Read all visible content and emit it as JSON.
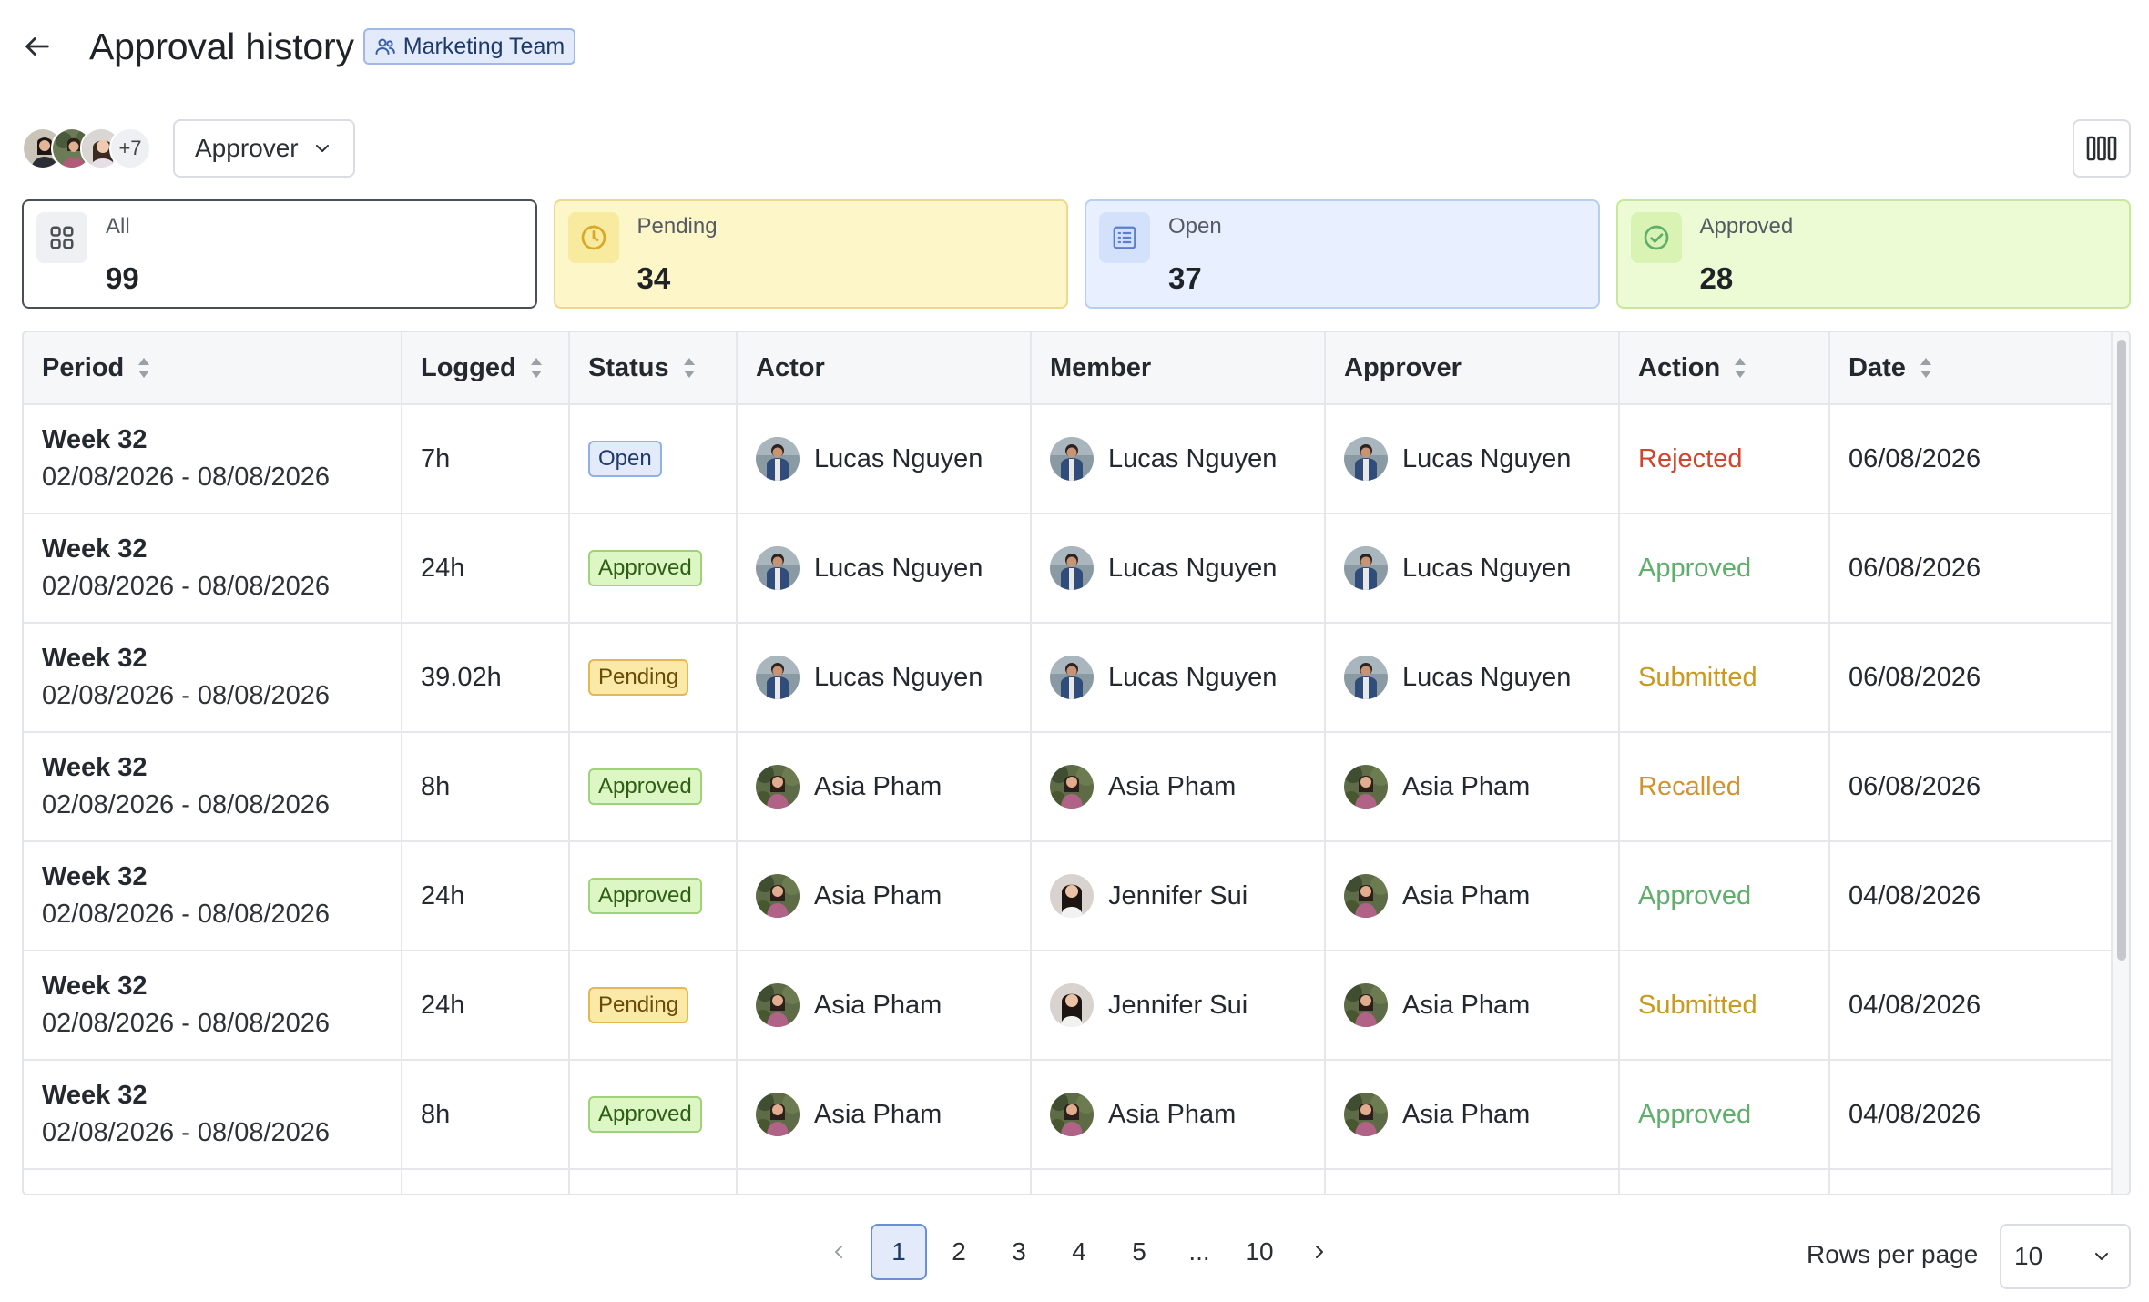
{
  "header": {
    "title": "Approval history",
    "team_badge": "Marketing Team",
    "back_icon": "arrow-left-icon",
    "team_icon": "users-icon"
  },
  "toolbar": {
    "avatars_more": "+7",
    "approver_label": "Approver",
    "columns_icon": "columns-icon"
  },
  "stats": [
    {
      "key": "all",
      "label": "All",
      "value": "99",
      "icon": "grid-icon"
    },
    {
      "key": "pending",
      "label": "Pending",
      "value": "34",
      "icon": "clock-icon",
      "color": "#d9b12b"
    },
    {
      "key": "open",
      "label": "Open",
      "value": "37",
      "icon": "list-icon",
      "color": "#5b7fd0"
    },
    {
      "key": "approved",
      "label": "Approved",
      "value": "28",
      "icon": "check-circle-icon",
      "color": "#5fae6c"
    }
  ],
  "table": {
    "columns": [
      {
        "label": "Period",
        "sortable": true
      },
      {
        "label": "Logged",
        "sortable": true
      },
      {
        "label": "Status",
        "sortable": true
      },
      {
        "label": "Actor",
        "sortable": false
      },
      {
        "label": "Member",
        "sortable": false
      },
      {
        "label": "Approver",
        "sortable": false
      },
      {
        "label": "Action",
        "sortable": true
      },
      {
        "label": "Date",
        "sortable": true
      }
    ],
    "rows": [
      {
        "week": "Week 32",
        "range": "02/08/2026 - 08/08/2026",
        "logged": "7h",
        "status": "Open",
        "actor": "Lucas Nguyen",
        "member": "Lucas Nguyen",
        "approver": "Lucas Nguyen",
        "action": "Rejected",
        "date": "06/08/2026"
      },
      {
        "week": "Week 32",
        "range": "02/08/2026 - 08/08/2026",
        "logged": "24h",
        "status": "Approved",
        "actor": "Lucas Nguyen",
        "member": "Lucas Nguyen",
        "approver": "Lucas Nguyen",
        "action": "Approved",
        "date": "06/08/2026"
      },
      {
        "week": "Week 32",
        "range": "02/08/2026 - 08/08/2026",
        "logged": "39.02h",
        "status": "Pending",
        "actor": "Lucas Nguyen",
        "member": "Lucas Nguyen",
        "approver": "Lucas Nguyen",
        "action": "Submitted",
        "date": "06/08/2026"
      },
      {
        "week": "Week 32",
        "range": "02/08/2026 - 08/08/2026",
        "logged": "8h",
        "status": "Approved",
        "actor": "Asia Pham",
        "member": "Asia Pham",
        "approver": "Asia Pham",
        "action": "Recalled",
        "date": "06/08/2026"
      },
      {
        "week": "Week 32",
        "range": "02/08/2026 - 08/08/2026",
        "logged": "24h",
        "status": "Approved",
        "actor": "Asia Pham",
        "member": "Jennifer Sui",
        "approver": "Asia Pham",
        "action": "Approved",
        "date": "04/08/2026"
      },
      {
        "week": "Week 32",
        "range": "02/08/2026 - 08/08/2026",
        "logged": "24h",
        "status": "Pending",
        "actor": "Asia Pham",
        "member": "Jennifer Sui",
        "approver": "Asia Pham",
        "action": "Submitted",
        "date": "04/08/2026"
      },
      {
        "week": "Week 32",
        "range": "02/08/2026 - 08/08/2026",
        "logged": "8h",
        "status": "Approved",
        "actor": "Asia Pham",
        "member": "Asia Pham",
        "approver": "Asia Pham",
        "action": "Approved",
        "date": "04/08/2026"
      }
    ]
  },
  "pagination": {
    "pages": [
      "1",
      "2",
      "3",
      "4",
      "5",
      "...",
      "10"
    ],
    "current": "1",
    "prev_icon": "chevron-left-icon",
    "next_icon": "chevron-right-icon"
  },
  "rows_per_page": {
    "label": "Rows per page",
    "value": "10"
  }
}
